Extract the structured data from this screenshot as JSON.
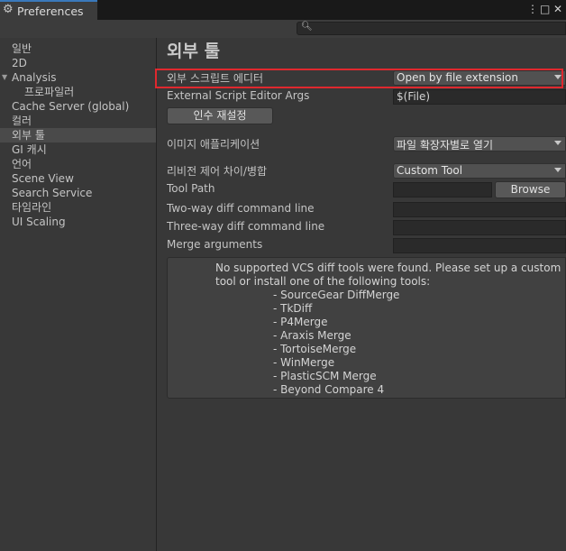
{
  "window": {
    "title": "Preferences",
    "controls": [
      "⋮",
      "□",
      "✕"
    ]
  },
  "search": {
    "placeholder": ""
  },
  "sidebar": {
    "items": [
      {
        "label": "일반"
      },
      {
        "label": "2D"
      },
      {
        "label": "Analysis"
      },
      {
        "label": "프로파일러"
      },
      {
        "label": "Cache Server (global)"
      },
      {
        "label": "컬러"
      },
      {
        "label": "외부 툴"
      },
      {
        "label": "GI 캐시"
      },
      {
        "label": "언어"
      },
      {
        "label": "Scene View"
      },
      {
        "label": "Search Service"
      },
      {
        "label": "타임라인"
      },
      {
        "label": "UI Scaling"
      }
    ],
    "selected": "외부 툴"
  },
  "main": {
    "heading": "외부 툴",
    "script_editor": {
      "label": "외부 스크립트 에디터",
      "value": "Open by file extension"
    },
    "editor_args": {
      "label": "External Script Editor Args",
      "value": "$(File)"
    },
    "reset_button": "인수 재설정",
    "image_app": {
      "label": "이미지 애플리케이션",
      "value": "파일 확장자별로 열기"
    },
    "revision_diff": {
      "label": "리비전 제어 차이/병합",
      "value": "Custom Tool"
    },
    "tool_path": {
      "label": "Tool Path",
      "value": ""
    },
    "browse_button": "Browse",
    "two_way": {
      "label": "Two-way diff command line",
      "value": ""
    },
    "three_way": {
      "label": "Three-way diff command line",
      "value": ""
    },
    "merge_args": {
      "label": "Merge arguments",
      "value": ""
    },
    "help": {
      "message": "No supported VCS diff tools were found. Please set up a custom tool or install one of the following tools:",
      "tools": [
        "- SourceGear DiffMerge",
        "- TkDiff",
        "- P4Merge",
        "- Araxis Merge",
        "- TortoiseMerge",
        "- WinMerge",
        "- PlasticSCM Merge",
        "- Beyond Compare 4"
      ]
    }
  },
  "colors": {
    "highlight": "#e0282e",
    "tab_accent": "#3a79bb",
    "background": "#383838"
  }
}
